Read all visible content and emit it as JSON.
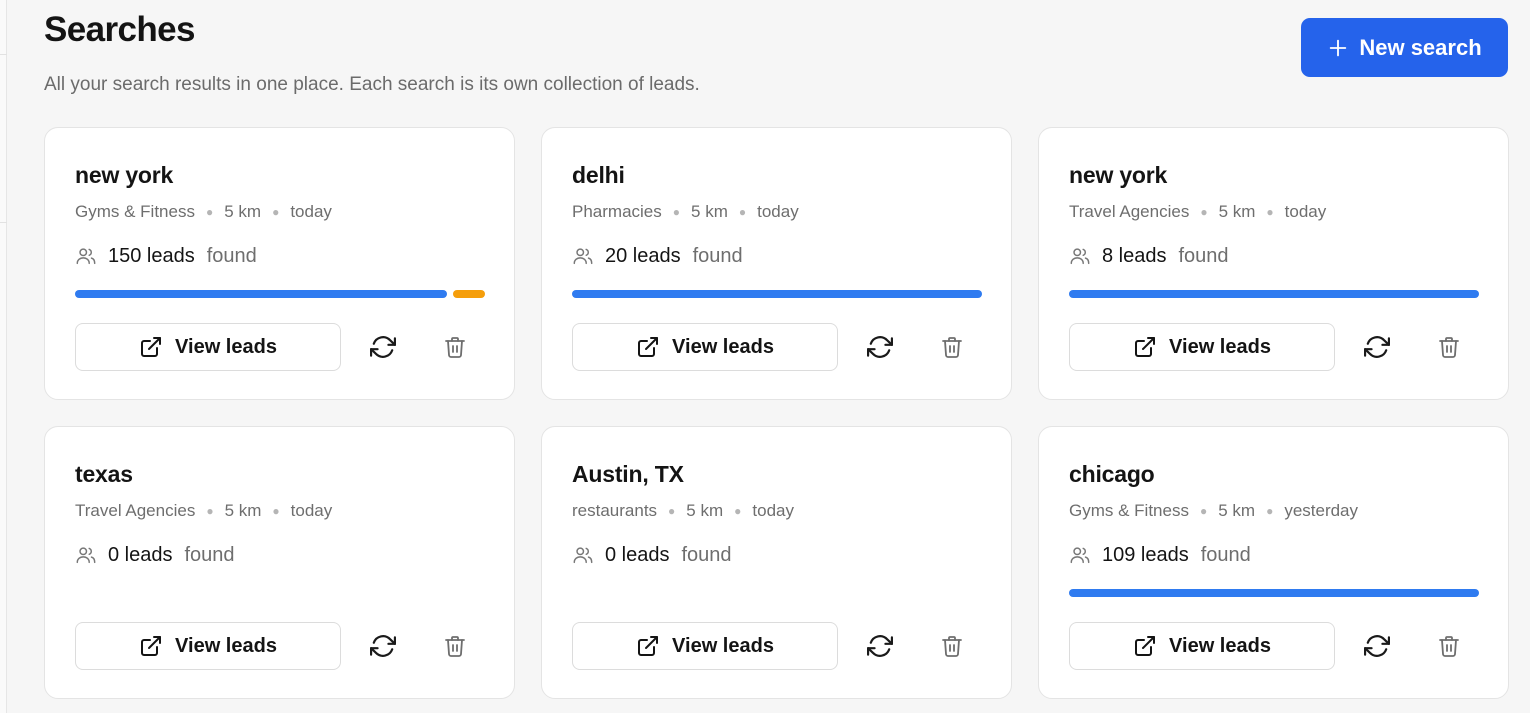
{
  "header": {
    "title": "Searches",
    "subtitle": "All your search results in one place. Each search is its own collection of leads.",
    "new_search_label": "New search"
  },
  "colors": {
    "primary": "#2563eb",
    "progress_blue": "#2f7bf0",
    "progress_orange": "#f59e0b"
  },
  "cards": [
    {
      "title": "new york",
      "category": "Gyms & Fitness",
      "radius": "5 km",
      "date": "today",
      "leads": "150 leads",
      "found_label": "found",
      "progress": [
        0.92,
        0.08
      ],
      "view_label": "View leads"
    },
    {
      "title": "delhi",
      "category": "Pharmacies",
      "radius": "5 km",
      "date": "today",
      "leads": "20 leads",
      "found_label": "found",
      "progress": [
        1.0,
        0.0
      ],
      "view_label": "View leads"
    },
    {
      "title": "new york",
      "category": "Travel Agencies",
      "radius": "5 km",
      "date": "today",
      "leads": "8 leads",
      "found_label": "found",
      "progress": [
        1.0,
        0.0
      ],
      "view_label": "View leads"
    },
    {
      "title": "texas",
      "category": "Travel Agencies",
      "radius": "5 km",
      "date": "today",
      "leads": "0 leads",
      "found_label": "found",
      "progress": [],
      "view_label": "View leads"
    },
    {
      "title": "Austin, TX",
      "category": "restaurants",
      "radius": "5 km",
      "date": "today",
      "leads": "0 leads",
      "found_label": "found",
      "progress": [],
      "view_label": "View leads"
    },
    {
      "title": "chicago",
      "category": "Gyms & Fitness",
      "radius": "5 km",
      "date": "yesterday",
      "leads": "109 leads",
      "found_label": "found",
      "progress": [
        1.0,
        0.0
      ],
      "view_label": "View leads"
    }
  ],
  "icons": {
    "new_search": "plus-icon",
    "leads": "users-icon",
    "view": "external-link-icon",
    "refresh": "refresh-icon",
    "delete": "trash-icon"
  }
}
